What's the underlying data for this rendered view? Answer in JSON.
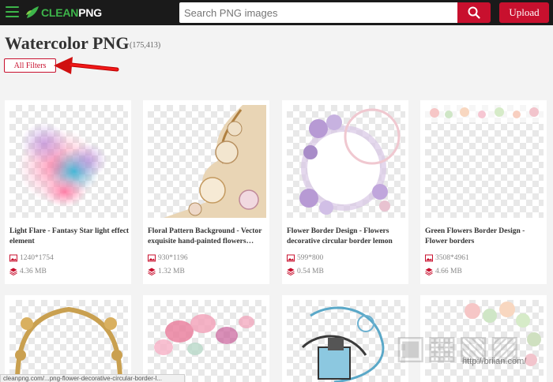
{
  "header": {
    "logo_part1": "CLEAN",
    "logo_part2": "PNG",
    "search_placeholder": "Search PNG images",
    "upload_label": "Upload",
    "accent_color": "#c8102e",
    "brand_green": "#3db54a"
  },
  "page": {
    "title": "Watercolor PNG",
    "count": "(175,413)",
    "filters_label": "All Filters"
  },
  "cards": [
    {
      "title": "Light Flare - Fantasy Star light effect element",
      "dimensions": "1240*1754",
      "size": "4.36 MB"
    },
    {
      "title": "Floral Pattern Background - Vector exquisite hand-painted flowers…",
      "dimensions": "930*1196",
      "size": "1.32 MB"
    },
    {
      "title": "Flower Border Design - Flowers decorative circular border lemon",
      "dimensions": "599*800",
      "size": "0.54 MB"
    },
    {
      "title": "Green Flowers Border Design - Flower borders",
      "dimensions": "3508*4961",
      "size": "4.66 MB"
    },
    {
      "title": "",
      "dimensions": "",
      "size": ""
    },
    {
      "title": "",
      "dimensions": "",
      "size": ""
    },
    {
      "title": "",
      "dimensions": "",
      "size": ""
    },
    {
      "title": "",
      "dimensions": "",
      "size": ""
    }
  ],
  "status_bar": "cleanpng.com/...png-flower-decorative-circular-border-l...",
  "watermark_url": "http://briian.com/"
}
